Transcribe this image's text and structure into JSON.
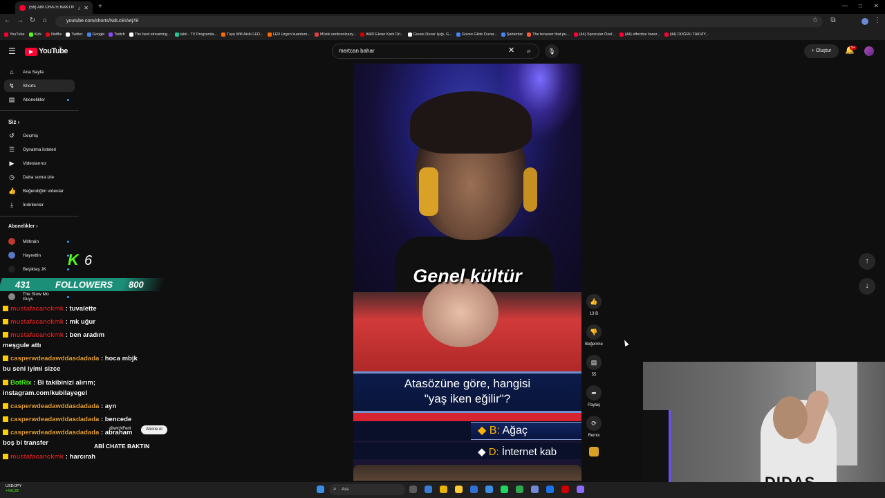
{
  "browser": {
    "tab_title": "(58) ABİ CHATE BAKTIN - Yo",
    "url": "youtube.com/shorts/NdLcEIAej7E",
    "bookmarks": [
      {
        "label": "YouTube",
        "color": "#ff0033"
      },
      {
        "label": "Kick",
        "color": "#53fc18"
      },
      {
        "label": "Netflix",
        "color": "#e50914"
      },
      {
        "label": "Twitter",
        "color": "#ffffff"
      },
      {
        "label": "Google",
        "color": "#4285f4"
      },
      {
        "label": "Twitch",
        "color": "#9146ff"
      },
      {
        "label": "The best streaming...",
        "color": "#ffffff"
      },
      {
        "label": "tabii - TV Programla...",
        "color": "#20c997"
      },
      {
        "label": "Tuya Wifi Akıllı LED...",
        "color": "#ff6a00"
      },
      {
        "label": "LED üzgen kuantum...",
        "color": "#ff6a00"
      },
      {
        "label": "Müzik senkronizasy...",
        "color": "#e04040"
      },
      {
        "label": "AMD Ekran Kartı Dri...",
        "color": "#cc0000"
      },
      {
        "label": "Govee Duvar Işığı, G...",
        "color": "#ffffff"
      },
      {
        "label": "Govee Glide Duvar...",
        "color": "#4285f4"
      },
      {
        "label": "Şablonlar",
        "color": "#4285f4"
      },
      {
        "label": "The browser that pu...",
        "color": "#ff5a36"
      },
      {
        "label": "(44) Sporcular Özel...",
        "color": "#ff0033"
      },
      {
        "label": "(44) effective lower...",
        "color": "#ff0033"
      },
      {
        "label": "(44) DOĞRU TAKVİY...",
        "color": "#ff0033"
      }
    ]
  },
  "header": {
    "logo_text": "YouTube",
    "logo_sup": "TR",
    "search_value": "mertcan bahar",
    "create_label": "Oluştur",
    "notif_badge": "9+"
  },
  "sidebar": {
    "main": [
      {
        "label": "Ana Sayfa",
        "icon": "home-icon",
        "glyph": "⌂"
      },
      {
        "label": "Shorts",
        "icon": "shorts-icon",
        "glyph": "↯"
      },
      {
        "label": "Abonelikler",
        "icon": "subscriptions-icon",
        "glyph": "▤"
      }
    ],
    "you_heading": "Siz",
    "you_items": [
      {
        "label": "Geçmiş",
        "icon": "history-icon",
        "glyph": "↺"
      },
      {
        "label": "Oynatma listeleri",
        "icon": "playlist-icon",
        "glyph": "☰"
      },
      {
        "label": "Videolarınız",
        "icon": "your-videos-icon",
        "glyph": "▶"
      },
      {
        "label": "Daha sonra izle",
        "icon": "watch-later-icon",
        "glyph": "◷"
      },
      {
        "label": "Beğendiğim videolar",
        "icon": "liked-icon",
        "glyph": "👍"
      },
      {
        "label": "İndirilenler",
        "icon": "download-icon",
        "glyph": "⤓"
      }
    ],
    "subs_heading": "Abonelikler",
    "subs": [
      {
        "label": "Mithrain",
        "color": "#c0392b"
      },
      {
        "label": "Hayrettin",
        "color": "#5a78c8"
      },
      {
        "label": "Beşiktaş JK",
        "color": "#222222"
      },
      {
        "label": "The Slow Mo Guys",
        "color": "#888888"
      }
    ]
  },
  "overlay": {
    "kick_count": "6",
    "followers_count": "431",
    "followers_label": "FOLLOWERS",
    "followers_goal": "800",
    "chat": [
      {
        "user": "mustafacanckmk",
        "msg": ": tuvalette",
        "user_class": "red"
      },
      {
        "user": "mustafacanckmk",
        "msg": ": mk uğur",
        "user_class": "red"
      },
      {
        "user": "mustafacanckmk",
        "msg": ": ben aradım",
        "user_class": "red"
      },
      {
        "user": "",
        "msg": "meşgule attı",
        "user_class": ""
      },
      {
        "user": "casperwdeadawddasdadada",
        "msg": ": hoca mbjk",
        "user_class": ""
      },
      {
        "user": "",
        "msg": "bu seni iyimi sizce",
        "user_class": ""
      },
      {
        "user": "BotRix",
        "msg": ": Bi takibinizi alırım;",
        "user_class": "green"
      },
      {
        "user": "",
        "msg": "instagram.com/kubilayegel",
        "user_class": ""
      },
      {
        "user": "casperwdeadawddasdadada",
        "msg": ": ayn",
        "user_class": ""
      },
      {
        "user": "casperwdeadawddasdadada",
        "msg": ": bencede",
        "user_class": ""
      },
      {
        "user": "casperwdeadawddasdadada",
        "msg": ": abraham",
        "user_class": ""
      },
      {
        "user": "",
        "msg": "boş bi transfer",
        "user_class": ""
      },
      {
        "user": "mustafacanckmk",
        "msg": ": harcırah",
        "user_class": "red"
      }
    ],
    "channel_handle": "@wtcNFerit",
    "subscribe_label": "Abone ol",
    "video_title": "ABİ CHATE BAKTIN"
  },
  "short": {
    "caption": "Genel kültür",
    "question_line1": "Atasözüne göre, hangisi",
    "question_line2": "\"yaş iken eğilir\"?",
    "answer_b_letter": "B:",
    "answer_b": "Ağaç",
    "answer_d_letter": "D:",
    "answer_d": "İnternet kab"
  },
  "actions": {
    "like_count": "13 B",
    "dislike_label": "Beğenme",
    "comment_count": "55",
    "share_label": "Paylaş",
    "remix_label": "Remix"
  },
  "webcam": {
    "shirt_text": "DIDAS"
  },
  "taskbar": {
    "search_placeholder": "Ara",
    "ticker_pair": "USD/JPY",
    "ticker_change": "+%0,28"
  }
}
